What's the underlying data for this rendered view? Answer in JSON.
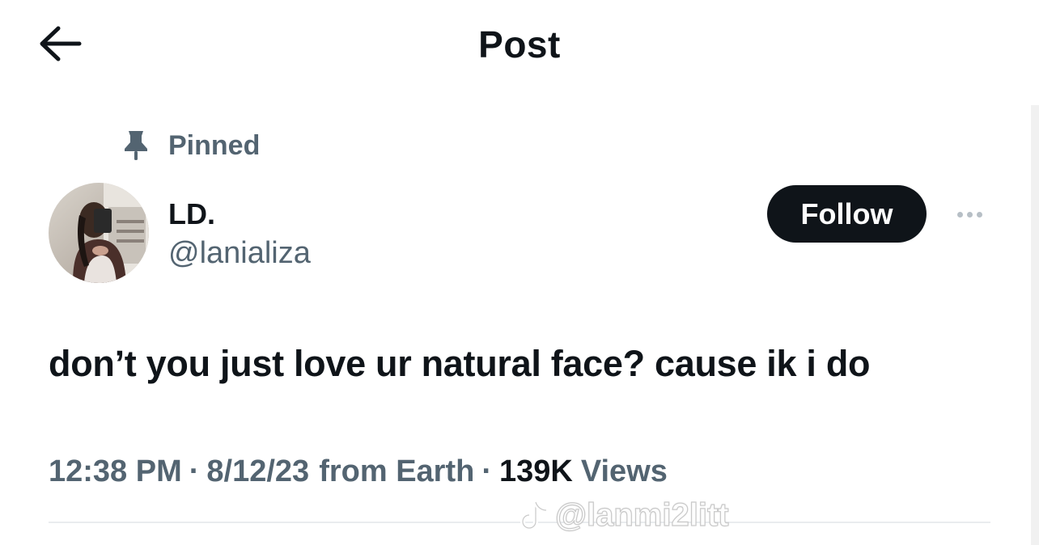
{
  "header": {
    "title": "Post",
    "back_icon": "arrow-left-icon"
  },
  "post": {
    "pinned_label": "Pinned",
    "pin_icon": "pin-icon",
    "author": {
      "name": "LD.",
      "handle": "@lanializa"
    },
    "follow_label": "Follow",
    "more_icon": "more-horizontal-icon",
    "text": "don’t you just love ur natural face? cause ik i do",
    "meta": {
      "time": "12:38 PM",
      "date": "8/12/23",
      "source": "from Earth",
      "separator": "·",
      "views_count": "139K",
      "views_label": "Views"
    }
  },
  "watermark": {
    "icon": "tiktok-icon",
    "text": "@lanmi2litt"
  },
  "colors": {
    "primary_text": "#0f1419",
    "secondary_text": "#536471",
    "follow_bg": "#0f1419",
    "follow_text": "#ffffff"
  }
}
